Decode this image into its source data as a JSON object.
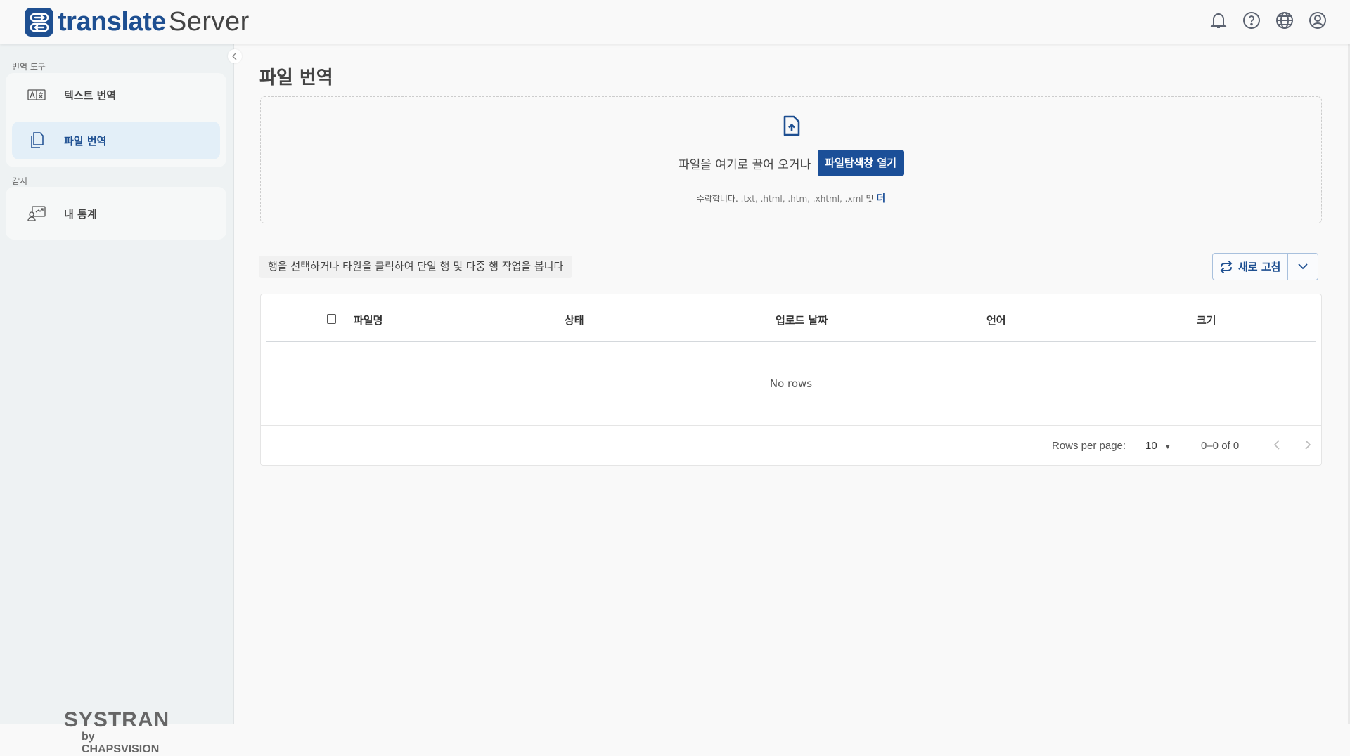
{
  "header": {
    "logo_primary": "translate",
    "logo_secondary": "Server",
    "icons": [
      "bell-icon",
      "help-icon",
      "globe-icon",
      "user-icon"
    ]
  },
  "sidebar": {
    "sections": [
      {
        "label": "번역 도구",
        "items": [
          {
            "label": "텍스트 번역",
            "icon": "text-translate-icon",
            "selected": false
          },
          {
            "label": "파일 번역",
            "icon": "file-copy-icon",
            "selected": true
          }
        ]
      },
      {
        "label": "감시",
        "items": [
          {
            "label": "내 통계",
            "icon": "stats-icon",
            "selected": false
          }
        ]
      }
    ],
    "brand": {
      "name": "SYSTRAN",
      "by": "by CHAPSVISION"
    }
  },
  "main": {
    "title": "파일 번역",
    "dropzone": {
      "drag_text": "파일을 여기로 끌어 오거나",
      "browse_label": "파일탐색창 열기",
      "accept_prefix": "수락합니다.",
      "accept_extensions": " .txt, .html, .htm, .xhtml, .xml ",
      "accept_and": "및",
      "accept_more": "더"
    },
    "hint": "행을 선택하거나 타원을 클릭하여 단일 행 및 다중 행 작업을 봅니다",
    "refresh_label": "새로 고침",
    "table": {
      "columns": [
        "파일명",
        "상태",
        "업로드 날짜",
        "언어",
        "크기"
      ],
      "rows": [],
      "empty_text": "No rows",
      "rows_per_page_label": "Rows per page:",
      "rows_per_page": "10",
      "range": "0–0 of 0"
    }
  },
  "colors": {
    "brand": "#1e4f91",
    "button": "#1b4f98",
    "selected_nav": "#e3eff8"
  }
}
